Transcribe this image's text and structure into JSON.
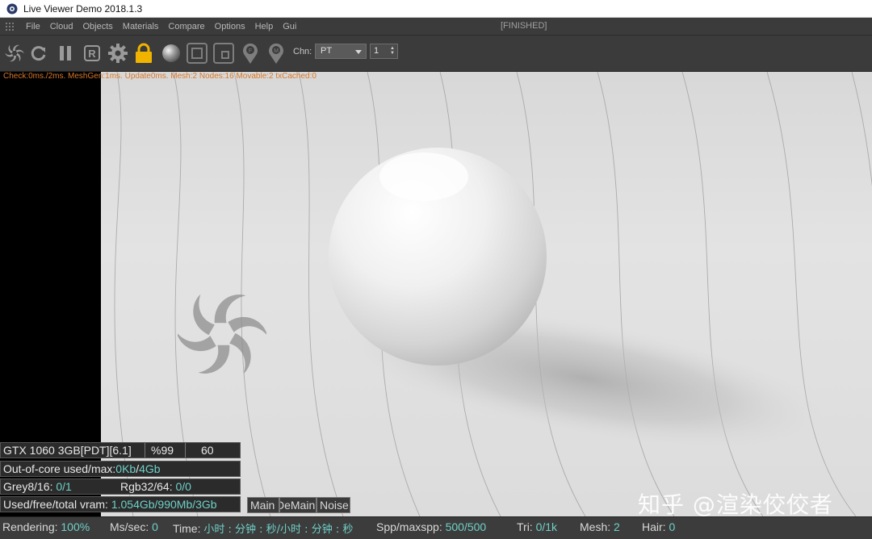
{
  "window": {
    "title": "Live Viewer Demo 2018.1.3"
  },
  "menu": {
    "items": [
      "File",
      "Cloud",
      "Objects",
      "Materials",
      "Compare",
      "Options",
      "Help",
      "Gui"
    ],
    "render_state": "[FINISHED]"
  },
  "toolbar": {
    "icons": [
      "octane-logo-icon",
      "restart-icon",
      "pause-icon",
      "region-render-icon",
      "settings-gear-icon",
      "lock-icon",
      "material-ball-icon",
      "frame-icon",
      "frame-small-icon",
      "pick-focus-icon",
      "pick-material-icon"
    ],
    "region_label": "R",
    "channel_label": "Chn:",
    "channel_value": "PT",
    "pass_value": "1"
  },
  "viewport": {
    "stats_line": "Check:0ms./2ms. MeshGen:1ms. Update0ms. Mesh:2 Nodes:16 Movable:2 txCached:0"
  },
  "gpu": {
    "name": "GTX 1060 3GB[PDT][6.1]",
    "usage": "%99",
    "temp": "60"
  },
  "out_of_core": {
    "label": "Out-of-core used/max:",
    "used": "0Kb",
    "slash": "/",
    "max": "4Gb"
  },
  "grey": {
    "label": "Grey8/16: ",
    "value": "0/1"
  },
  "rgb": {
    "label": "Rgb32/64: ",
    "value": "0/0"
  },
  "vram": {
    "label": "Used/free/total vram: ",
    "value": "1.054Gb/990Mb/3Gb"
  },
  "view_tabs": [
    "Main",
    "DeMain",
    "Noise"
  ],
  "watermark": "知乎 @渲染佼佼者",
  "status": {
    "rendering_label": "Rendering: ",
    "rendering_value": "100%",
    "ms_label": "Ms/sec: ",
    "ms_value": "0",
    "time_label": "Time: ",
    "time_value": "小时 : 分钟 : 秒/小时 : 分钟 : 秒",
    "spp_label": "Spp/maxspp: ",
    "spp_value": "500/500",
    "tri_label": "Tri: ",
    "tri_value": "0/1k",
    "mesh_label": "Mesh: ",
    "mesh_value": "2",
    "hair_label": "Hair: ",
    "hair_value": "0"
  },
  "colors": {
    "accent_value": "#6fd0c8",
    "stats_orange": "#d8782a",
    "lock_yellow": "#f0b400"
  }
}
